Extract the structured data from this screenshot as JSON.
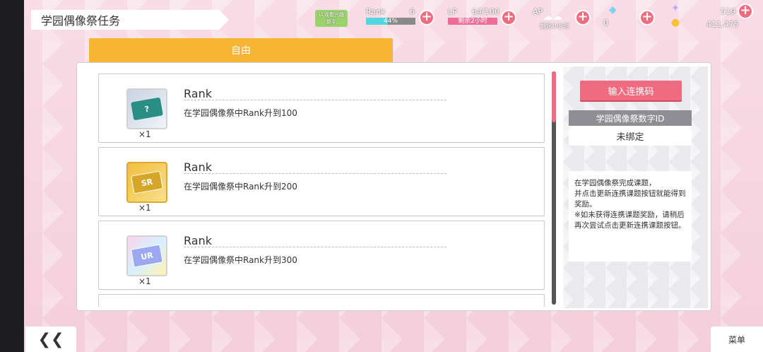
{
  "header": {
    "title": "学园偶像祭任务",
    "badge_label": "LL观看兴趣",
    "badge_sub": "新手",
    "rank_label": "Rank",
    "rank_value": "6",
    "rank_progress": "44%",
    "lp_label": "LP",
    "lp_value": "64/100",
    "lp_sub": "剩余2小时",
    "ap_label": "AP",
    "ap_sub": "剩余0小时",
    "gem_value": "0",
    "star_value": "519",
    "coin_value": "411,475",
    "colors": {
      "rank_bar": "#4fd6e1",
      "lp_bar": "#ef6b9a",
      "plus": "#ef6b7f"
    }
  },
  "tabs": [
    {
      "label": "自由",
      "active": true
    }
  ],
  "missions": [
    {
      "name": "Rank",
      "desc": "在学园偶像祭中Rank升到100",
      "qty": "×1",
      "icon": "ticket-normal-icon",
      "ticket_text": "?"
    },
    {
      "name": "Rank",
      "desc": "在学园偶像祭中Rank升到200",
      "qty": "×1",
      "icon": "ticket-sr-icon",
      "ticket_text": "SR"
    },
    {
      "name": "Rank",
      "desc": "在学园偶像祭中Rank升到300",
      "qty": "×1",
      "icon": "ticket-ur-icon",
      "ticket_text": "UR"
    }
  ],
  "right_pane": {
    "link_button": "输入连携码",
    "id_heading": "学园偶像祭数字ID",
    "id_value": "未绑定",
    "note": "在学园偶像祭完成课题，\n并点击更新连携课题按钮就能得到奖励。\n※如未获得连携课题奖励，请稍后再次尝试点击更新连携课题按钮。"
  },
  "footer": {
    "back_label": "❮❮",
    "menu_label": "菜单"
  }
}
